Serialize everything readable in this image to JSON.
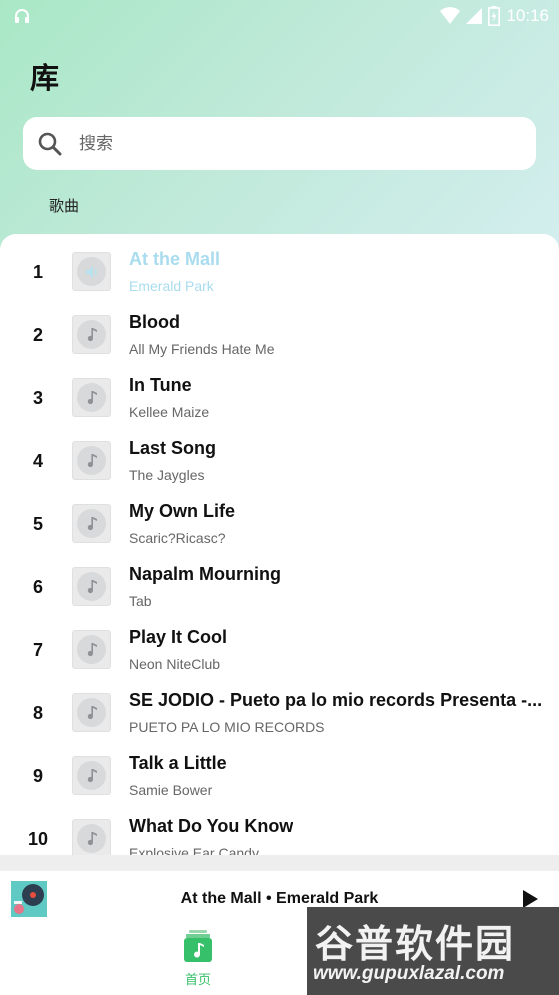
{
  "status_bar": {
    "time": "10:16"
  },
  "header": {
    "title": "库"
  },
  "search": {
    "placeholder": "搜索"
  },
  "section_tab": "歌曲",
  "songs": [
    {
      "num": "1",
      "title": "At the Mall",
      "artist": "Emerald Park",
      "playing": true
    },
    {
      "num": "2",
      "title": "Blood",
      "artist": "All My Friends Hate Me"
    },
    {
      "num": "3",
      "title": "In Tune",
      "artist": "Kellee Maize"
    },
    {
      "num": "4",
      "title": "Last Song",
      "artist": "The Jaygles"
    },
    {
      "num": "5",
      "title": "My Own Life",
      "artist": "Scaric?Ricasc?"
    },
    {
      "num": "6",
      "title": "Napalm Mourning",
      "artist": "Tab"
    },
    {
      "num": "7",
      "title": "Play It Cool",
      "artist": "Neon NiteClub"
    },
    {
      "num": "8",
      "title": "SE JODIO - Pueto pa lo mio records Presenta -...",
      "artist": "PUETO PA LO MIO RECORDS"
    },
    {
      "num": "9",
      "title": "Talk a Little",
      "artist": "Samie Bower"
    },
    {
      "num": "10",
      "title": "What Do You Know",
      "artist": "Explosive Ear Candy"
    }
  ],
  "mini_player": {
    "now_playing": "At the Mall • Emerald Park"
  },
  "bottom_nav": {
    "home_label": "首页"
  },
  "watermark": {
    "text": "谷普软件园",
    "url": "www.gupuxlazal.com"
  },
  "colors": {
    "accent_green": "#37c06a",
    "playing_blue": "#a9dcee"
  },
  "icons": [
    "headphones-icon",
    "wifi-icon",
    "signal-icon",
    "battery-icon",
    "search-icon",
    "music-note-icon",
    "speaker-icon",
    "play-icon",
    "music-app-icon"
  ]
}
